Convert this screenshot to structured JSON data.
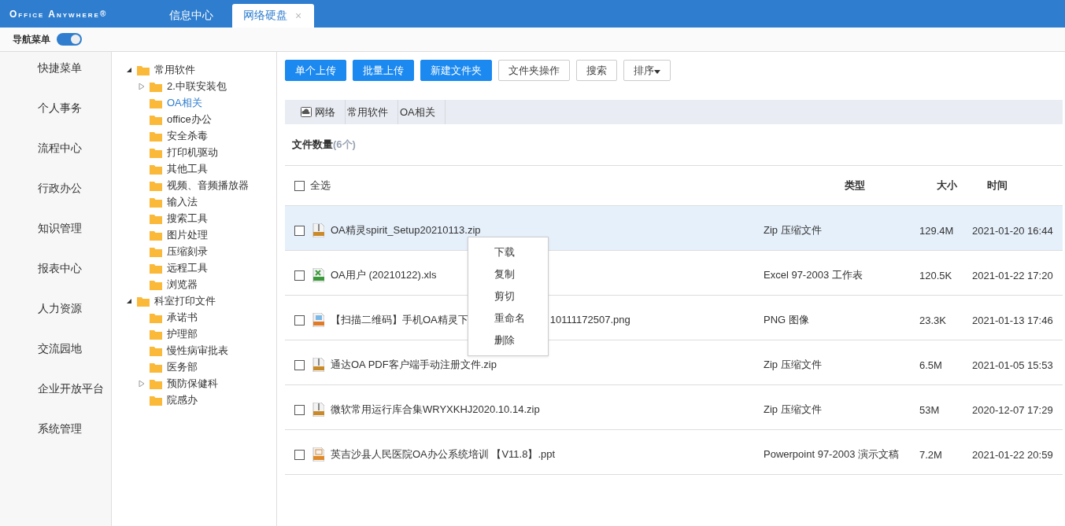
{
  "header": {
    "logo": "Office Anywhere",
    "logo_mark": "®",
    "tabs": [
      {
        "label": "信息中心",
        "selected": false,
        "closable": false
      },
      {
        "label": "网络硬盘",
        "selected": true,
        "closable": true,
        "close": "×"
      }
    ]
  },
  "nav_toggle": {
    "label": "导航菜单",
    "on": true
  },
  "sidebar": {
    "items": [
      "快捷菜单",
      "个人事务",
      "流程中心",
      "行政办公",
      "知识管理",
      "报表中心",
      "人力资源",
      "交流园地",
      "企业开放平台",
      "系统管理"
    ]
  },
  "tree": [
    {
      "label": "常用软件",
      "expanded": true,
      "selected": false,
      "children": [
        {
          "label": "2.中联安装包",
          "expanded": false,
          "selected": false
        },
        {
          "label": "OA相关",
          "selected": true
        },
        {
          "label": "office办公",
          "selected": false
        },
        {
          "label": "安全杀毒",
          "selected": false
        },
        {
          "label": "打印机驱动",
          "selected": false
        },
        {
          "label": "其他工具",
          "selected": false
        },
        {
          "label": "视频、音频播放器",
          "selected": false
        },
        {
          "label": "输入法",
          "selected": false
        },
        {
          "label": "搜索工具",
          "selected": false
        },
        {
          "label": "图片处理",
          "selected": false
        },
        {
          "label": "压缩刻录",
          "selected": false
        },
        {
          "label": "远程工具",
          "selected": false
        },
        {
          "label": "浏览器",
          "selected": false
        }
      ]
    },
    {
      "label": "科室打印文件",
      "expanded": true,
      "selected": false,
      "children": [
        {
          "label": "承诺书",
          "selected": false
        },
        {
          "label": "护理部",
          "selected": false
        },
        {
          "label": "慢性病审批表",
          "selected": false
        },
        {
          "label": "医务部",
          "selected": false
        },
        {
          "label": "预防保健科",
          "expanded": false,
          "selected": false
        },
        {
          "label": "院感办",
          "selected": false
        }
      ]
    }
  ],
  "toolbar": [
    {
      "label": "单个上传",
      "kind": "primary"
    },
    {
      "label": "批量上传",
      "kind": "primary"
    },
    {
      "label": "新建文件夹",
      "kind": "primary"
    },
    {
      "label": "文件夹操作",
      "kind": "plain"
    },
    {
      "label": "搜索",
      "kind": "plain"
    },
    {
      "label": "排序",
      "kind": "dropdown"
    }
  ],
  "breadcrumb": [
    "网络",
    "常用软件",
    "OA相关"
  ],
  "file_count": {
    "label": "文件数量",
    "count": "(6个)"
  },
  "table": {
    "select_all": {
      "label": "全选",
      "checked": false
    },
    "columns": [
      "类型",
      "大小",
      "时间"
    ],
    "rows": [
      {
        "kind": "zip",
        "name": "OA精灵spirit_Setup20210113.zip",
        "type": "Zip 压缩文件",
        "size": "129.4M",
        "time": "2021-01-20 16:44",
        "checked": false,
        "hovered": true
      },
      {
        "kind": "xls",
        "name": "OA用户 (20210122).xls",
        "type": "Excel 97-2003 工作表",
        "size": "120.5K",
        "time": "2021-01-22 17:20",
        "checked": false,
        "hovered": false
      },
      {
        "kind": "png",
        "name": "【扫描二维码】手机OA精灵下",
        "name_tail": "10111172507.png",
        "type": "PNG 图像",
        "size": "23.3K",
        "time": "2021-01-13 17:46",
        "checked": false,
        "hovered": false
      },
      {
        "kind": "zip",
        "name": "通达OA PDF客户端手动注册文件.zip",
        "type": "Zip 压缩文件",
        "size": "6.5M",
        "time": "2021-01-05 15:53",
        "checked": false,
        "hovered": false
      },
      {
        "kind": "zip",
        "name": "微软常用运行库合集WRYXKHJ2020.10.14.zip",
        "type": "Zip 压缩文件",
        "size": "53M",
        "time": "2020-12-07 17:29",
        "checked": false,
        "hovered": false
      },
      {
        "kind": "ppt",
        "name": "英吉沙县人民医院OA办公系统培训 【V11.8】.ppt",
        "type": "Powerpoint 97-2003 演示文稿",
        "size": "7.2M",
        "time": "2021-01-22 20:59",
        "checked": false,
        "hovered": false
      }
    ]
  },
  "context_menu": [
    "下载",
    "复制",
    "剪切",
    "重命名",
    "删除"
  ]
}
